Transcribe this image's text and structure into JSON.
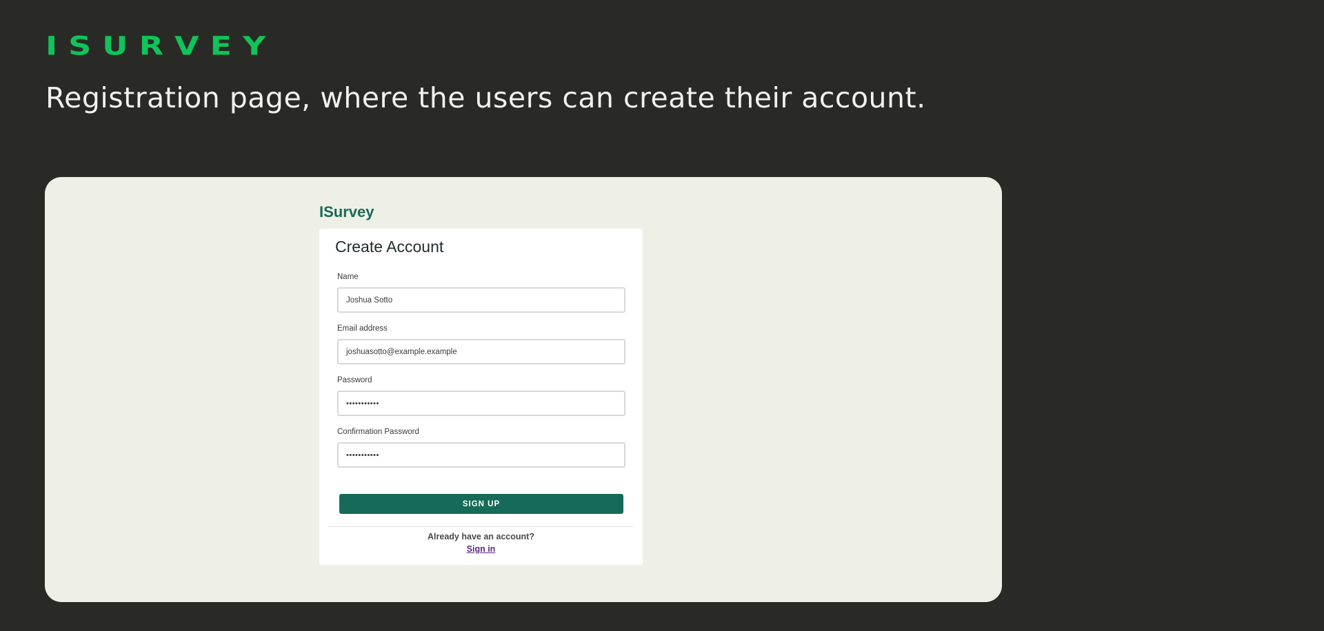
{
  "header": {
    "brand": "ISURVEY",
    "subtitle": "Registration page, where the users can create their account."
  },
  "app": {
    "logo": "ISurvey",
    "card_title": "Create Account",
    "fields": [
      {
        "label": "Name",
        "value": "Joshua Sotto"
      },
      {
        "label": "Email address",
        "value": "joshuasotto@example.example"
      },
      {
        "label": "Password",
        "value": "•••••••••••"
      },
      {
        "label": "Confirmation Password",
        "value": "•••••••••••"
      }
    ],
    "signup_label": "SIGN UP",
    "already_text": "Already have an account?",
    "signin_label": "Sign in"
  },
  "colors": {
    "background": "#292a25",
    "brand": "#10c35a",
    "panel": "#eef0e8",
    "primary_button": "#166a58",
    "link": "#5a2a86"
  }
}
